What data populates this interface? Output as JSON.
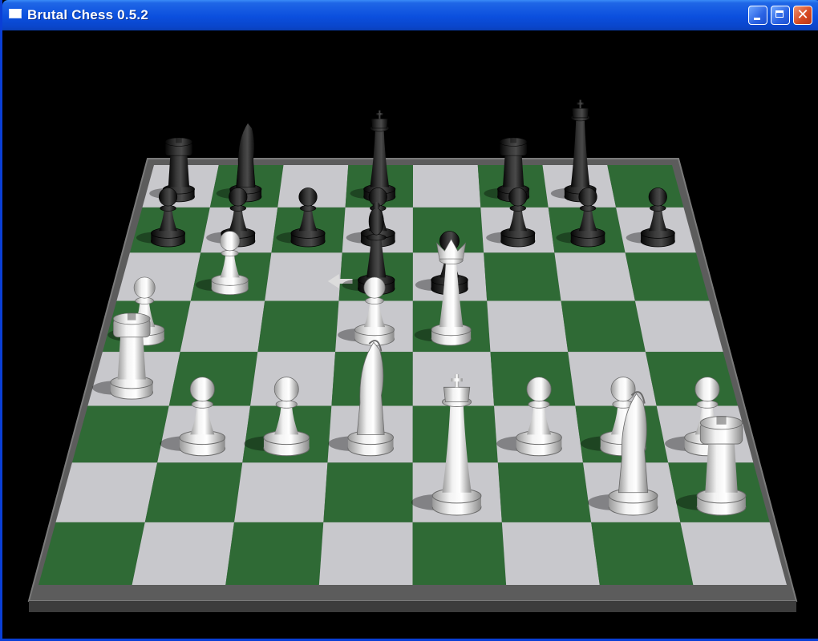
{
  "window": {
    "title": "Brutal Chess 0.5.2",
    "close_glyph": "✕"
  },
  "board": {
    "files": 8,
    "ranks": 8,
    "light_square_color": "#c8c8cc",
    "dark_square_color": "#2f6a35",
    "frame_color": "#5c5c5c",
    "last_move_arrow": {
      "from": "d6",
      "to": "c6",
      "color": "#dcdcdc"
    }
  },
  "pieces": [
    {
      "color": "black",
      "type": "rook",
      "square": "a8"
    },
    {
      "color": "black",
      "type": "knight",
      "square": "b8"
    },
    {
      "color": "black",
      "type": "king",
      "square": "d8"
    },
    {
      "color": "black",
      "type": "rook",
      "square": "f8"
    },
    {
      "color": "black",
      "type": "king2",
      "square": "g8"
    },
    {
      "color": "black",
      "type": "pawn",
      "square": "a7"
    },
    {
      "color": "black",
      "type": "pawn",
      "square": "b7"
    },
    {
      "color": "black",
      "type": "pawn",
      "square": "c7"
    },
    {
      "color": "black",
      "type": "pawn",
      "square": "d7"
    },
    {
      "color": "black",
      "type": "pawn",
      "square": "f7"
    },
    {
      "color": "black",
      "type": "pawn",
      "square": "g7"
    },
    {
      "color": "black",
      "type": "pawn",
      "square": "h7"
    },
    {
      "color": "black",
      "type": "bishop",
      "square": "d6"
    },
    {
      "color": "black",
      "type": "pawn",
      "square": "e6"
    },
    {
      "color": "white",
      "type": "pawn",
      "square": "b6"
    },
    {
      "color": "white",
      "type": "queen",
      "square": "e5"
    },
    {
      "color": "white",
      "type": "pawn",
      "square": "a5"
    },
    {
      "color": "white",
      "type": "pawn",
      "square": "d5"
    },
    {
      "color": "white",
      "type": "rook",
      "square": "a4"
    },
    {
      "color": "white",
      "type": "pawn",
      "square": "b3"
    },
    {
      "color": "white",
      "type": "pawn",
      "square": "c3"
    },
    {
      "color": "white",
      "type": "knight",
      "square": "d3"
    },
    {
      "color": "white",
      "type": "pawn",
      "square": "f3"
    },
    {
      "color": "white",
      "type": "pawn",
      "square": "g3"
    },
    {
      "color": "white",
      "type": "pawn",
      "square": "h3"
    },
    {
      "color": "white",
      "type": "king",
      "square": "e2"
    },
    {
      "color": "white",
      "type": "knight",
      "square": "g2"
    },
    {
      "color": "white",
      "type": "rook",
      "square": "h2"
    }
  ]
}
